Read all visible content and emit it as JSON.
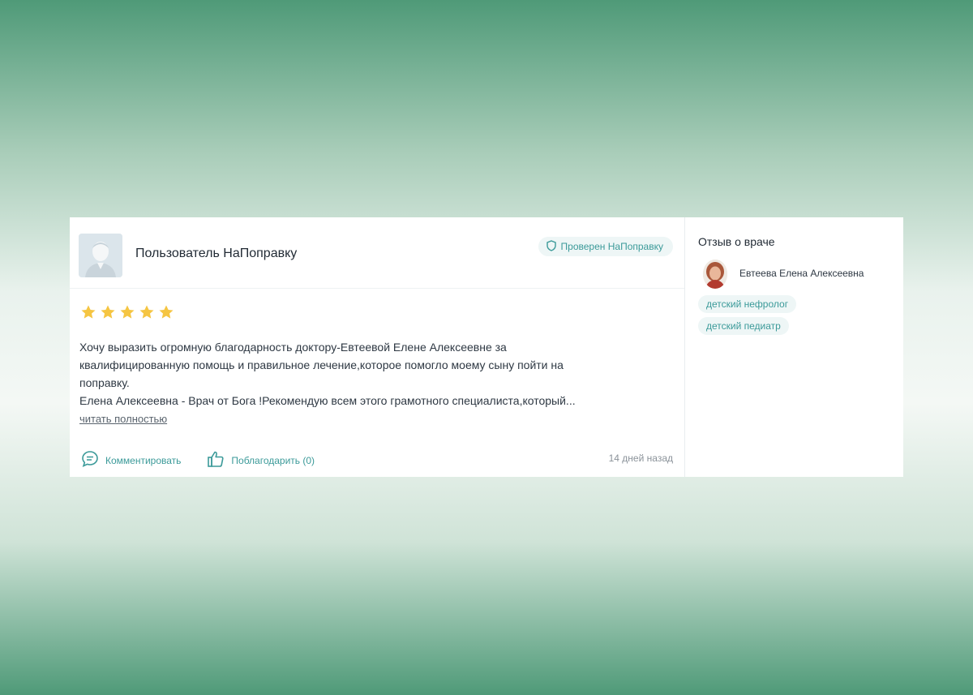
{
  "review": {
    "username": "Пользователь НаПоправку",
    "verified_label": "Проверен НаПоправку",
    "rating": 5,
    "text_lines": [
      "Хочу выразить огромную благодарность доктору-Евтеевой Елене Алексеевне за",
      "квалифицированную помощь и правильное лечение,которое помогло моему сыну пойти на",
      "поправку.",
      "Елена Алексеевна - Врач от Бога !Рекомендую всем этого грамотного специалиста,который..."
    ],
    "read_more": "читать полностью",
    "comment_label": "Комментировать",
    "thank_label": "Поблагодарить (0)",
    "time_ago": "14 дней назад"
  },
  "side": {
    "title": "Отзыв о враче",
    "doctor_name": "Евтеева Елена Алексеевна",
    "tags": [
      "детский нефролог",
      "детский педиатр"
    ]
  },
  "colors": {
    "accent": "#3b9a99",
    "star": "#f5c542",
    "background_green": "#4f9a78"
  },
  "icons": [
    "user-avatar-icon",
    "shield-icon",
    "star-icon",
    "comment-icon",
    "thumbs-up-icon"
  ]
}
